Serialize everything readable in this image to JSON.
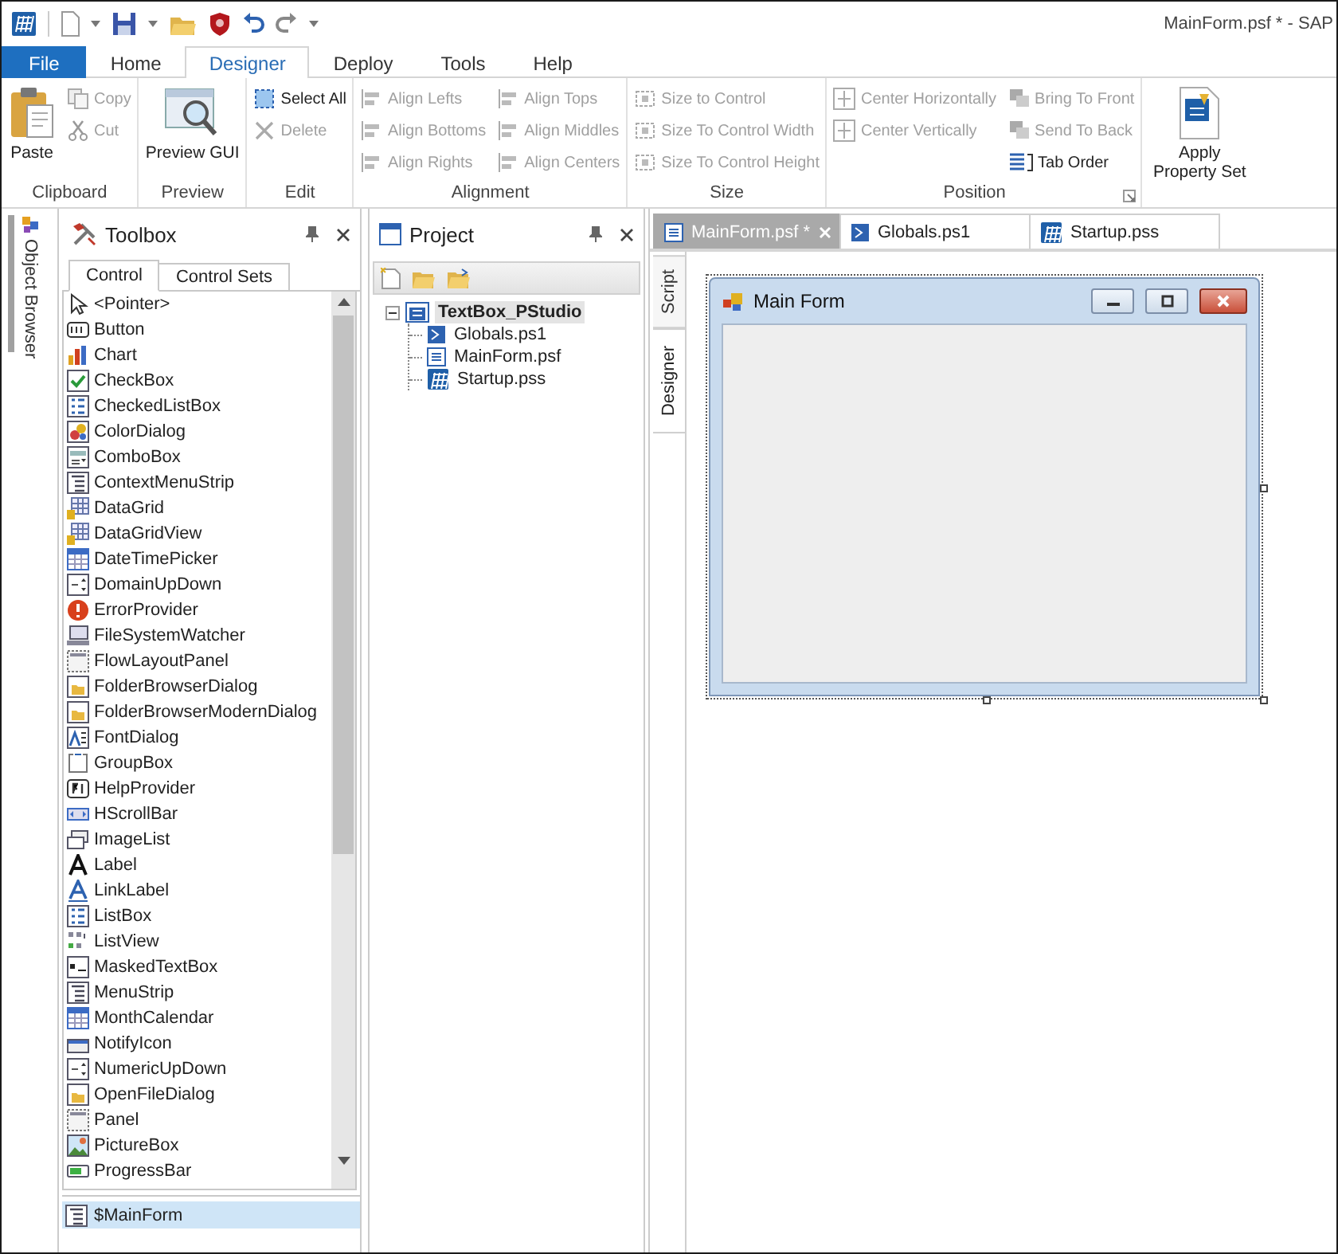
{
  "window": {
    "title": "MainForm.psf * - SAP"
  },
  "ribbon": {
    "tabs": [
      {
        "label": "File",
        "kind": "backstage",
        "selected": false
      },
      {
        "label": "Home",
        "kind": "tab",
        "selected": false
      },
      {
        "label": "Designer",
        "kind": "tab",
        "selected": true
      },
      {
        "label": "Deploy",
        "kind": "tab",
        "selected": false
      },
      {
        "label": "Tools",
        "kind": "tab",
        "selected": false
      },
      {
        "label": "Help",
        "kind": "tab",
        "selected": false
      }
    ],
    "groups": [
      {
        "label": "Clipboard",
        "columns": [
          [
            {
              "label": "Paste",
              "kind": "large",
              "disabled": false
            }
          ],
          [
            {
              "label": "Copy",
              "kind": "small",
              "disabled": true
            },
            {
              "label": "Cut",
              "kind": "small",
              "disabled": true
            }
          ]
        ]
      },
      {
        "label": "Preview",
        "columns": [
          [
            {
              "label": "Preview GUI",
              "kind": "large",
              "disabled": false
            }
          ]
        ]
      },
      {
        "label": "Edit",
        "columns": [
          [
            {
              "label": "Select All",
              "kind": "small",
              "disabled": false
            },
            {
              "label": "Delete",
              "kind": "small",
              "disabled": true
            }
          ]
        ]
      },
      {
        "label": "Alignment",
        "columns": [
          [
            {
              "label": "Align Lefts",
              "kind": "small",
              "disabled": true
            },
            {
              "label": "Align Bottoms",
              "kind": "small",
              "disabled": true
            },
            {
              "label": "Align Rights",
              "kind": "small",
              "disabled": true
            }
          ],
          [
            {
              "label": "Align Tops",
              "kind": "small",
              "disabled": true
            },
            {
              "label": "Align Middles",
              "kind": "small",
              "disabled": true
            },
            {
              "label": "Align Centers",
              "kind": "small",
              "disabled": true
            }
          ]
        ]
      },
      {
        "label": "Size",
        "columns": [
          [
            {
              "label": "Size to Control",
              "kind": "small",
              "disabled": true
            },
            {
              "label": "Size To Control Width",
              "kind": "small",
              "disabled": true
            },
            {
              "label": "Size To Control Height",
              "kind": "small",
              "disabled": true
            }
          ]
        ]
      },
      {
        "label": "Position",
        "launcher": true,
        "columns": [
          [
            {
              "label": "Center Horizontally",
              "kind": "small",
              "disabled": true
            },
            {
              "label": "Center Vertically",
              "kind": "small",
              "disabled": true
            }
          ],
          [
            {
              "label": "Bring To Front",
              "kind": "small",
              "disabled": true
            },
            {
              "label": "Send To Back",
              "kind": "small",
              "disabled": true
            },
            {
              "label": "Tab Order",
              "kind": "small",
              "disabled": false
            }
          ]
        ]
      },
      {
        "columns": [
          [
            {
              "label": "Apply Property Set",
              "kind": "large",
              "disabled": false
            }
          ]
        ]
      }
    ]
  },
  "side_tabs": [
    {
      "label": "Object Browser",
      "selected": true
    }
  ],
  "toolbox": {
    "title": "Toolbox",
    "tabs": [
      {
        "label": "Control",
        "selected": true
      },
      {
        "label": "Control Sets",
        "selected": false
      }
    ],
    "items": [
      "<Pointer>",
      "Button",
      "Chart",
      "CheckBox",
      "CheckedListBox",
      "ColorDialog",
      "ComboBox",
      "ContextMenuStrip",
      "DataGrid",
      "DataGridView",
      "DateTimePicker",
      "DomainUpDown",
      "ErrorProvider",
      "FileSystemWatcher",
      "FlowLayoutPanel",
      "FolderBrowserDialog",
      "FolderBrowserModernDialog",
      "FontDialog",
      "GroupBox",
      "HelpProvider",
      "HScrollBar",
      "ImageList",
      "Label",
      "LinkLabel",
      "ListBox",
      "ListView",
      "MaskedTextBox",
      "MenuStrip",
      "MonthCalendar",
      "NotifyIcon",
      "NumericUpDown",
      "OpenFileDialog",
      "Panel",
      "PictureBox",
      "ProgressBar"
    ],
    "tray": [
      {
        "label": "$MainForm",
        "selected": true
      }
    ]
  },
  "project": {
    "title": "Project",
    "tree": [
      {
        "label": "TextBox_PStudio",
        "expanded": true,
        "selected": true,
        "children": [
          {
            "label": "Globals.ps1"
          },
          {
            "label": "MainForm.psf"
          },
          {
            "label": "Startup.pss"
          }
        ]
      }
    ]
  },
  "editor": {
    "tabs": [
      {
        "label": "MainForm.psf *",
        "selected": true,
        "closable": true
      },
      {
        "label": "Globals.ps1",
        "selected": false
      },
      {
        "label": "Startup.pss",
        "selected": false
      }
    ],
    "view_tabs": [
      {
        "label": "Script",
        "selected": false
      },
      {
        "label": "Designer",
        "selected": true
      }
    ],
    "form": {
      "title": "Main Form"
    }
  }
}
